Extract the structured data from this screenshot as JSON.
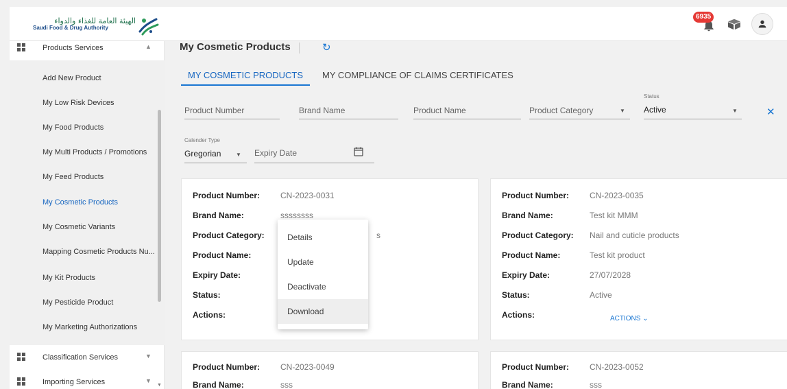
{
  "header": {
    "logo_arabic": "الهيئة العامة للغذاء والدواء",
    "logo_english": "Saudi Food & Drug Authority",
    "notification_count": "6935",
    "icons": [
      "bell-icon",
      "box-icon",
      "user-icon"
    ]
  },
  "sidebar": {
    "groups": [
      {
        "label": "Products Services",
        "expanded": true
      },
      {
        "label": "Classification Services",
        "expanded": false
      },
      {
        "label": "Importing Services",
        "expanded": false
      }
    ],
    "items": [
      {
        "label": "Add New Product"
      },
      {
        "label": "My Low Risk Devices"
      },
      {
        "label": "My Food Products"
      },
      {
        "label": "My Multi Products / Promotions"
      },
      {
        "label": "My Feed Products"
      },
      {
        "label": "My Cosmetic Products",
        "active": true
      },
      {
        "label": "My Cosmetic Variants"
      },
      {
        "label": "Mapping Cosmetic Products Nu..."
      },
      {
        "label": "My Kit Products"
      },
      {
        "label": "My Pesticide Product"
      },
      {
        "label": "My Marketing Authorizations"
      }
    ]
  },
  "main": {
    "title": "My Cosmetic Products",
    "tabs": [
      {
        "label": "MY COSMETIC PRODUCTS",
        "active": true
      },
      {
        "label": "MY COMPLIANCE OF CLAIMS CERTIFICATES",
        "active": false
      }
    ],
    "filters": {
      "product_number": "Product Number",
      "brand_name": "Brand Name",
      "product_name": "Product Name",
      "product_category": "Product Category",
      "status_label": "Status",
      "status_value": "Active",
      "calendar_label": "Calender Type",
      "calendar_value": "Gregorian",
      "expiry_date": "Expiry Date"
    },
    "field_labels": {
      "product_number": "Product Number:",
      "brand_name": "Brand Name:",
      "product_category": "Product Category:",
      "product_name": "Product Name:",
      "expiry_date": "Expiry Date:",
      "status": "Status:",
      "actions": "Actions:"
    },
    "actions_button": "ACTIONS",
    "cards": [
      {
        "product_number": "CN-2023-0031",
        "brand_name": "ssssssss",
        "product_category_partial": "s"
      },
      {
        "product_number": "CN-2023-0035",
        "brand_name": "Test kit MMM",
        "product_category": "Nail and cuticle products",
        "product_name": "Test kit product",
        "expiry_date": "27/07/2028",
        "status": "Active"
      },
      {
        "product_number": "CN-2023-0049",
        "brand_name": "sss"
      },
      {
        "product_number": "CN-2023-0052",
        "brand_name": "sss"
      }
    ],
    "context_menu": [
      "Details",
      "Update",
      "Deactivate",
      "Download"
    ],
    "context_menu_hovered": "Download"
  }
}
